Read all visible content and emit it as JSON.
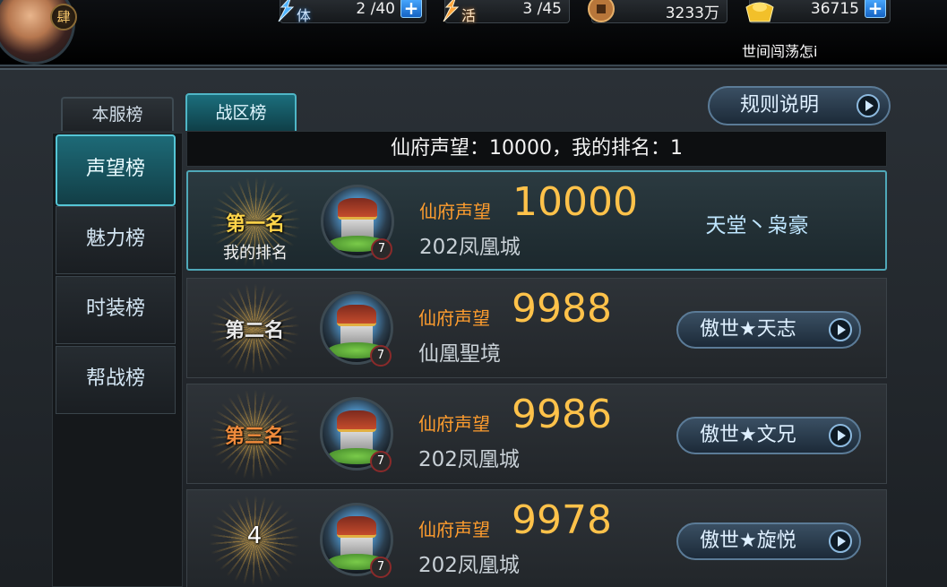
{
  "header": {
    "avatar_level": "肆",
    "resources": [
      {
        "name": "stamina",
        "label": "体",
        "value": "2 /40",
        "has_plus": true,
        "icon": "lightning-icon"
      },
      {
        "name": "vitality",
        "label": "活",
        "value": "3 /45",
        "has_plus": false,
        "icon": "lightning-icon"
      },
      {
        "name": "coins",
        "label": "",
        "value": "3233万",
        "has_plus": false,
        "icon": "coin-icon"
      },
      {
        "name": "ingots",
        "label": "",
        "value": "36715",
        "has_plus": true,
        "icon": "ingot-icon"
      }
    ],
    "marquee": "世间闯荡怎i"
  },
  "tabs": {
    "server": "本服榜",
    "zone": "战区榜",
    "active": "zone"
  },
  "rules_button": "规则说明",
  "sidebar": {
    "items": [
      {
        "label": "声望榜",
        "active": true
      },
      {
        "label": "魅力榜",
        "active": false
      },
      {
        "label": "时装榜",
        "active": false
      },
      {
        "label": "帮战榜",
        "active": false
      }
    ]
  },
  "summary": "仙府声望：10000，我的排名：1",
  "rank_label": "仙府声望",
  "house_level": "7",
  "ranks": [
    {
      "rank": "第一名",
      "sub": "我的排名",
      "value": "10000",
      "server": "202凤凰城",
      "owner": "天堂丶枭豪",
      "is_me": true
    },
    {
      "rank": "第二名",
      "sub": "",
      "value": "9988",
      "server": "仙凰聖境",
      "owner": "傲世★天志",
      "is_me": false
    },
    {
      "rank": "第三名",
      "sub": "",
      "value": "9986",
      "server": "202凤凰城",
      "owner": "傲世★文兄",
      "is_me": false
    },
    {
      "rank": "4",
      "sub": "",
      "value": "9978",
      "server": "202凤凰城",
      "owner": "傲世★旋悦",
      "is_me": false
    }
  ],
  "colors": {
    "gold": "#ffc24a",
    "orange_label": "#ff9d2e",
    "teal_active": "#1b6e7c",
    "panel": "#2a3036"
  }
}
